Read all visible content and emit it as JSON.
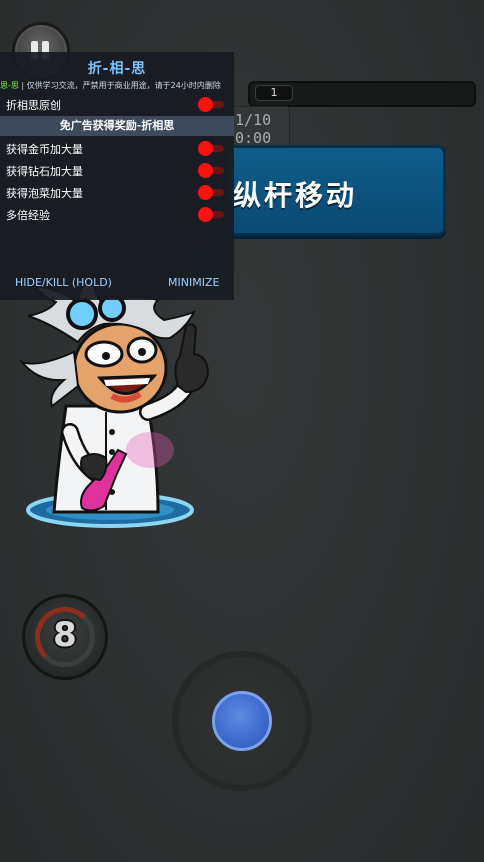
{
  "menu": {
    "title": "折-相-思",
    "notice_tag": "思-思",
    "notice_text": " | 仅供学习交流，严禁用于商业用途，请于24小时内删除",
    "original_toggle": {
      "label": "折相思原创",
      "state": "on"
    },
    "section_header": "免广告获得奖励-折相思",
    "items": [
      {
        "label": "获得金币加大量",
        "state": "on"
      },
      {
        "label": "获得钻石加大量",
        "state": "on"
      },
      {
        "label": "获得泡菜加大量",
        "state": "on"
      },
      {
        "label": "多倍经验",
        "state": "on"
      }
    ],
    "hide_kill_label": "HIDE/KILL (HOLD)",
    "minimize_label": "MINIMIZE"
  },
  "hud": {
    "progress_value": "1",
    "stat_text": "1/10\n0:00",
    "banner_text": "纵杆移动",
    "ability_count": "8"
  },
  "colors": {
    "accent_blue": "#7cc2ff",
    "toggle_on": "#ff1010",
    "banner_blue": "#0f5c8a",
    "joystick_knob": "#3f6cd0"
  }
}
